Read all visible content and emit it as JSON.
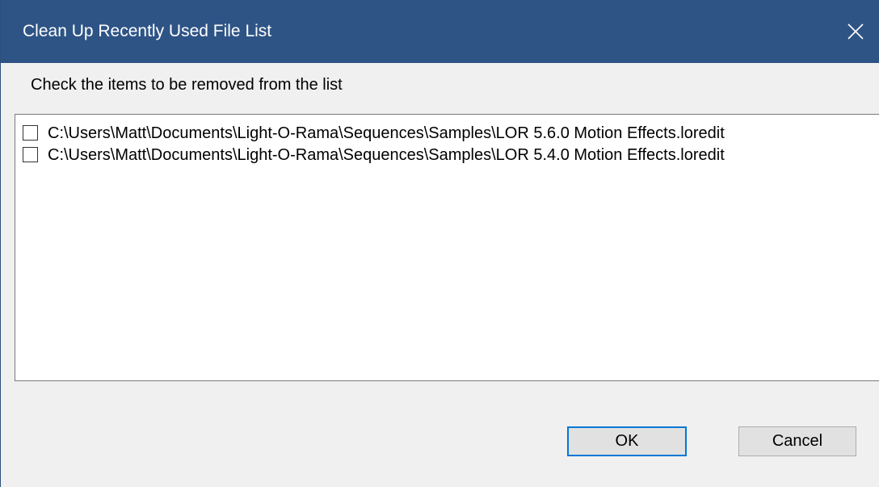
{
  "window": {
    "title": "Clean Up Recently Used File List"
  },
  "instruction": "Check the items to be removed from the list",
  "file_list": {
    "items": [
      {
        "path": "C:\\Users\\Matt\\Documents\\Light-O-Rama\\Sequences\\Samples\\LOR 5.6.0 Motion Effects.loredit",
        "checked": false
      },
      {
        "path": "C:\\Users\\Matt\\Documents\\Light-O-Rama\\Sequences\\Samples\\LOR 5.4.0 Motion Effects.loredit",
        "checked": false
      }
    ]
  },
  "buttons": {
    "ok_label": "OK",
    "cancel_label": "Cancel"
  },
  "icons": {
    "close": "close-icon"
  },
  "colors": {
    "titlebar": "#2e5486",
    "default_button_border": "#0078d7"
  }
}
